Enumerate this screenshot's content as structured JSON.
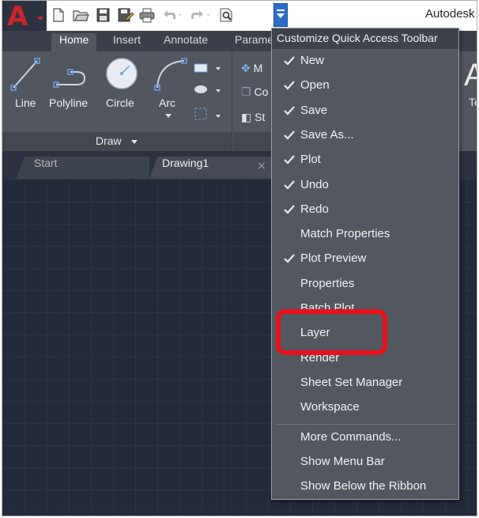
{
  "app": {
    "logo_letter": "A",
    "title_text": "Autodesk"
  },
  "quick_access": {
    "icons": [
      "new-icon",
      "open-icon",
      "save-icon",
      "save-as-icon",
      "plot-icon",
      "undo-icon",
      "redo-icon",
      "plot-preview-icon"
    ],
    "dropdown_icon": "chevron-down-icon"
  },
  "ribbon": {
    "tabs": [
      "Home",
      "Insert",
      "Annotate",
      "Parame"
    ],
    "active_tab": "Home",
    "draw_tools": [
      "Line",
      "Polyline",
      "Circle",
      "Arc"
    ],
    "draw_panel_label": "Draw",
    "modify_items": [
      "M",
      "Co",
      "St"
    ]
  },
  "doc_tabs": {
    "start": "Start",
    "drawing": "Drawing1",
    "close_glyph": "×"
  },
  "menu": {
    "header": "Customize Quick Access Toolbar",
    "items": [
      {
        "label": "New",
        "checked": true
      },
      {
        "label": "Open",
        "checked": true
      },
      {
        "label": "Save",
        "checked": true
      },
      {
        "label": "Save As...",
        "checked": true
      },
      {
        "label": "Plot",
        "checked": true
      },
      {
        "label": "Undo",
        "checked": true
      },
      {
        "label": "Redo",
        "checked": true
      },
      {
        "label": "Match Properties",
        "checked": false
      },
      {
        "label": "Plot Preview",
        "checked": true
      },
      {
        "label": "Properties",
        "checked": false
      },
      {
        "label": "Batch Plot",
        "checked": false
      },
      {
        "label": "Layer",
        "checked": false
      },
      {
        "label": "Render",
        "checked": false
      },
      {
        "label": "Sheet Set Manager",
        "checked": false
      },
      {
        "label": "Workspace",
        "checked": false
      }
    ],
    "commands": [
      "More Commands...",
      "Show Menu Bar",
      "Show Below the Ribbon"
    ]
  },
  "annotation": {
    "highlight_color": "#e8101a",
    "highlighted_item": "Layer"
  },
  "colors": {
    "canvas": "#232938",
    "ribbon": "#51565f",
    "menu": "#525760",
    "app_accent": "#c8262c"
  }
}
